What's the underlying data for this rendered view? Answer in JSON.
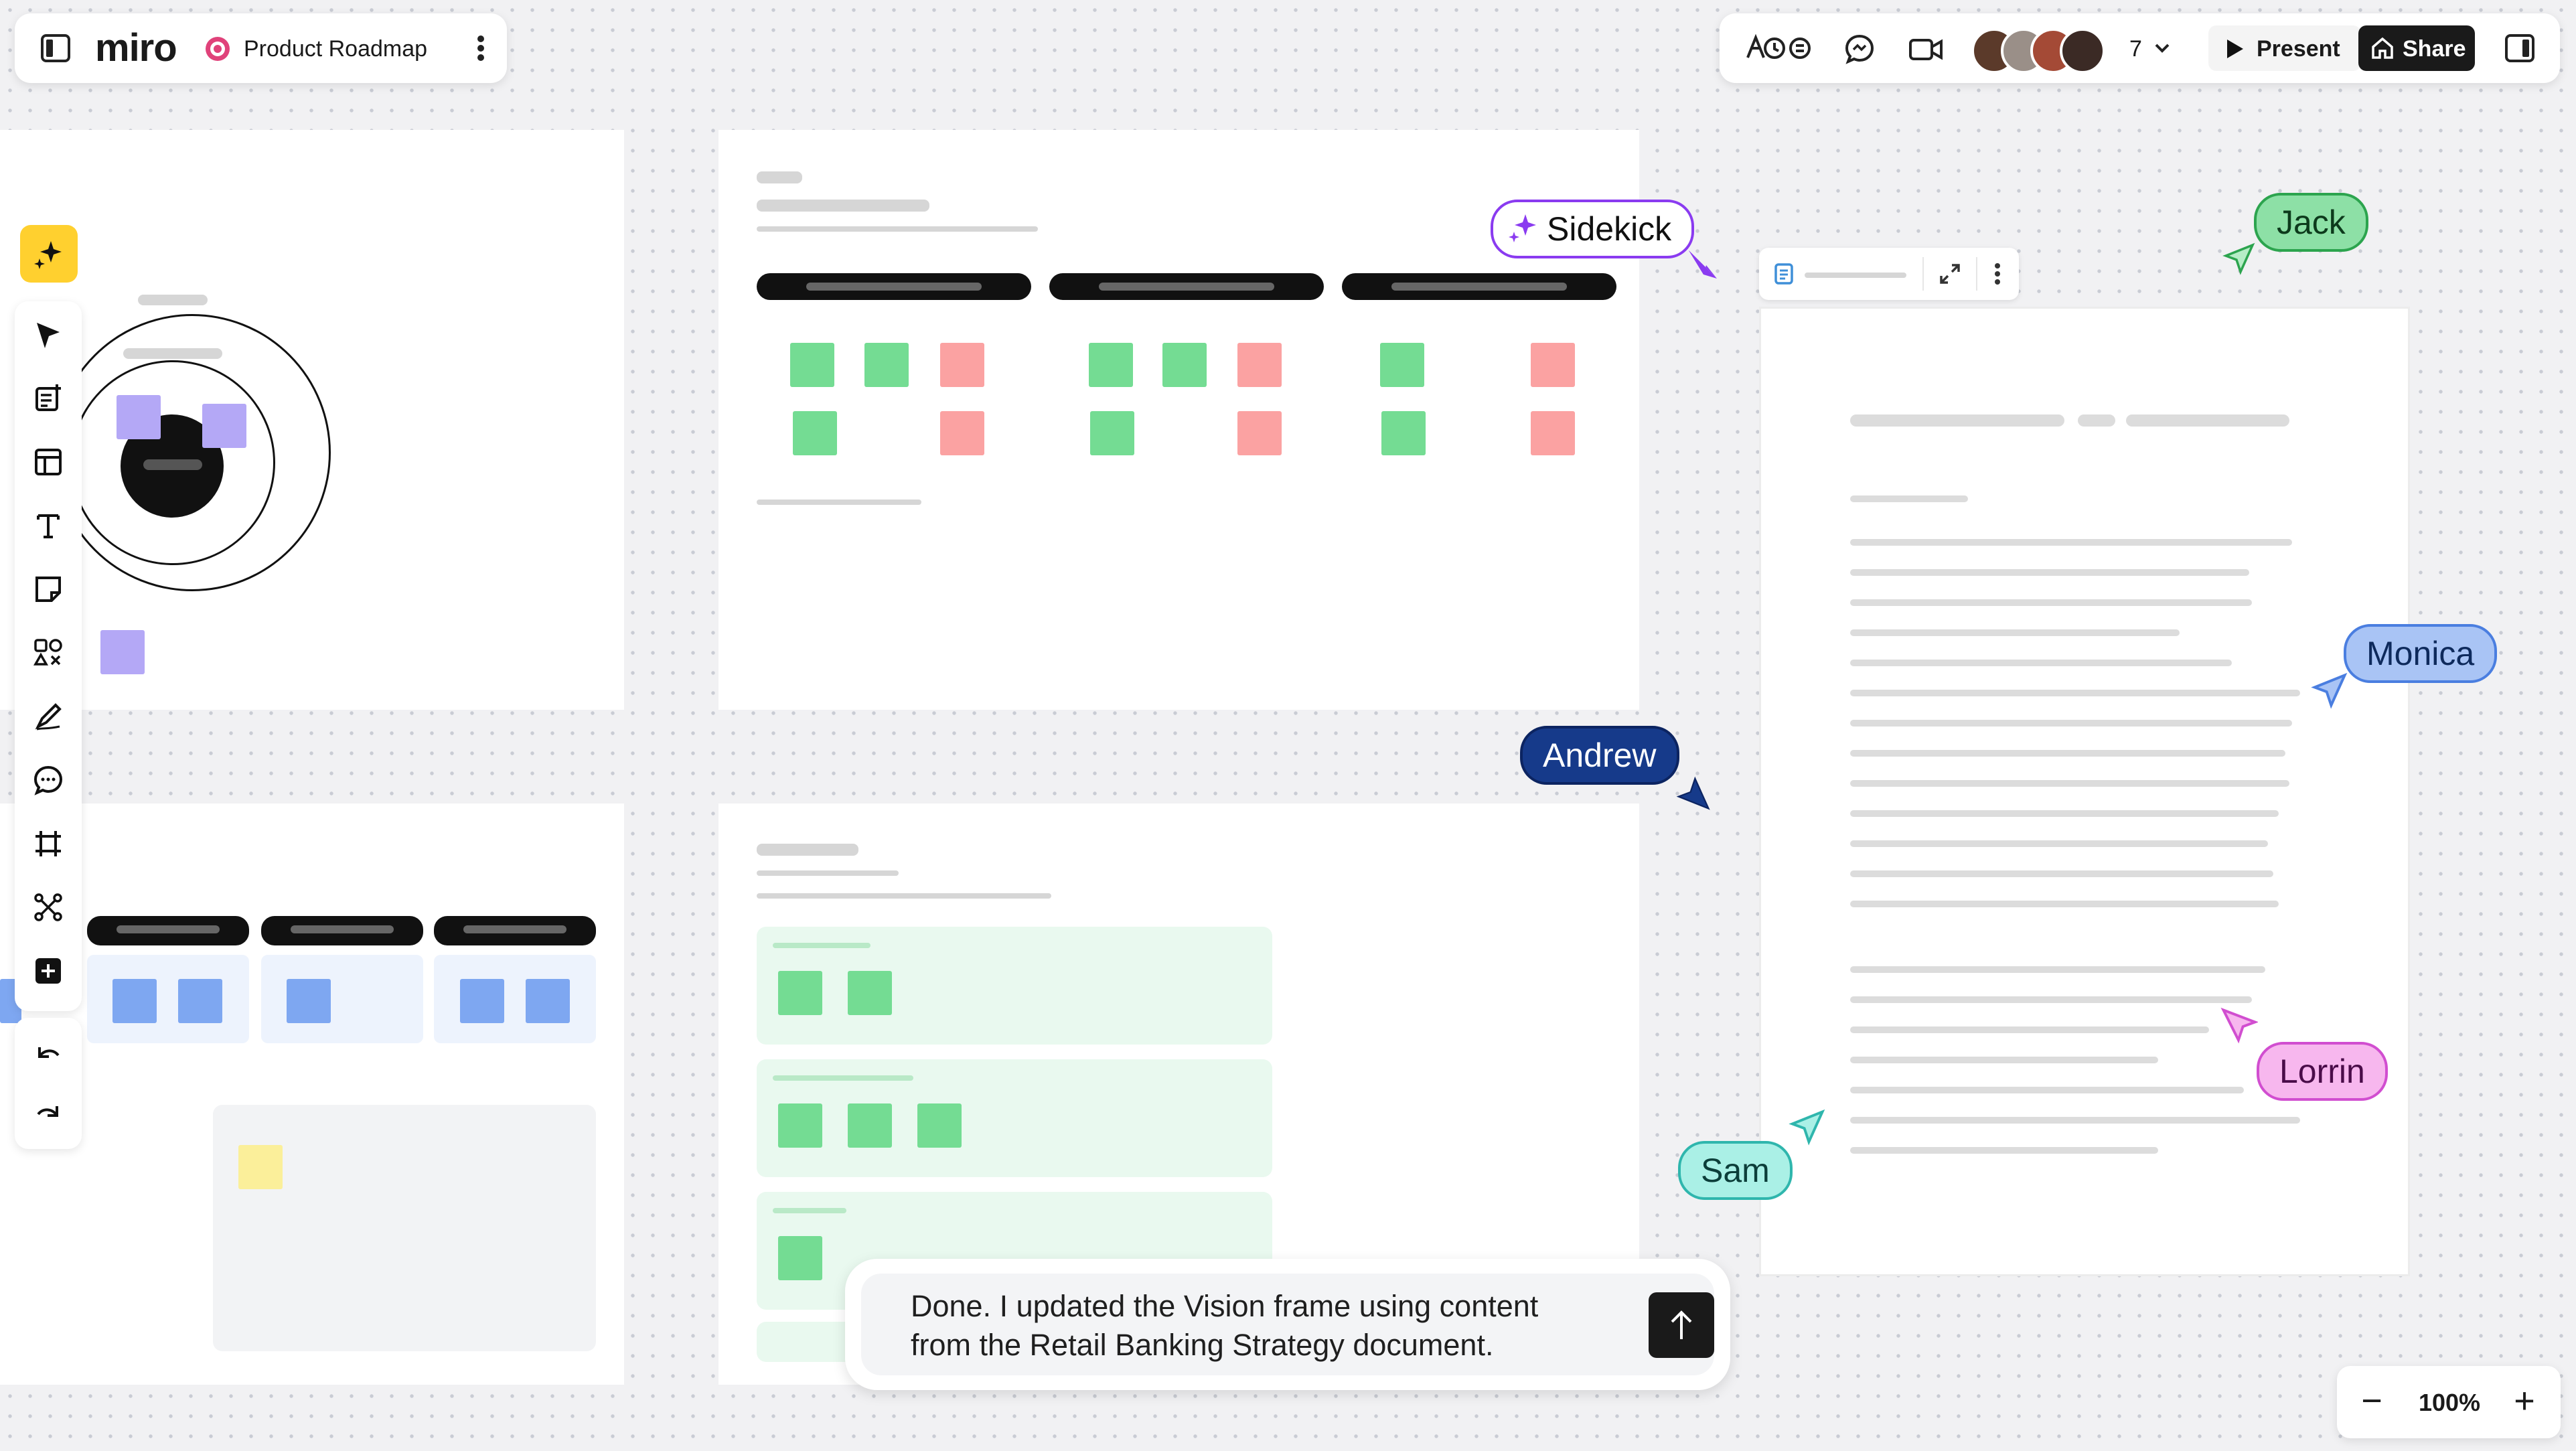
{
  "app": {
    "logo": "miro",
    "board_name": "Product Roadmap",
    "colors": {
      "accent": "#ffd02f",
      "brand": "#050038",
      "board_icon": "#e0427a"
    }
  },
  "topbar": {
    "collaborator_count": "7",
    "present_label": "Present",
    "share_label": "Share",
    "icons": [
      "sidebar-toggle-icon",
      "board-icon",
      "more-vertical-icon",
      "reactions-icon",
      "chat-icon",
      "video-icon",
      "chevron-down-icon",
      "play-icon",
      "share-house-icon",
      "panel-toggle-icon"
    ]
  },
  "cursors": [
    {
      "name": "Sidekick",
      "color": "#8a3bf0"
    },
    {
      "name": "Jack",
      "color": "#2ca44e"
    },
    {
      "name": "Monica",
      "color": "#4a7ee0"
    },
    {
      "name": "Andrew",
      "color": "#163a8a"
    },
    {
      "name": "Lorrin",
      "color": "#d14ed0"
    },
    {
      "name": "Sam",
      "color": "#2fb6ad"
    }
  ],
  "toolbar": {
    "tools": [
      "sidekick-icon",
      "select-icon",
      "templates-icon",
      "layout-icon",
      "text-icon",
      "sticky-note-icon",
      "shapes-icon",
      "pen-icon",
      "comment-icon",
      "frame-icon",
      "mindmap-icon",
      "add-more-icon",
      "undo-icon",
      "redo-icon"
    ]
  },
  "chat": {
    "message": "Done. I updated the Vision frame using content from the Retail Banking Strategy document."
  },
  "zoom": {
    "level": "100%",
    "minus": "−",
    "plus": "+"
  }
}
